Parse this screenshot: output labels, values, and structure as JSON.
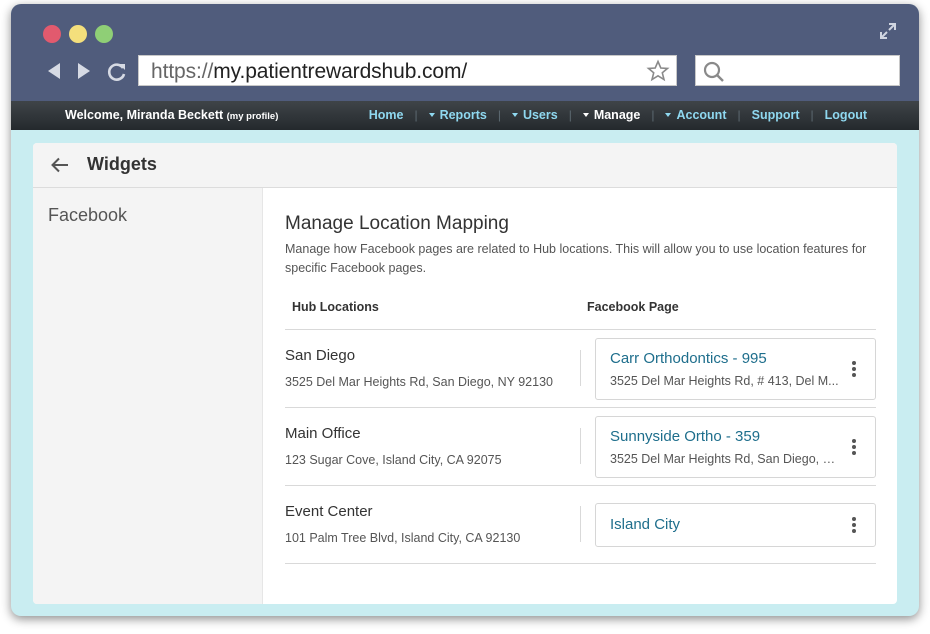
{
  "browser": {
    "url_scheme": "https://",
    "url_host": "my.patientrewardshub.com/",
    "search_value": ""
  },
  "topnav": {
    "welcome": "Welcome, Miranda Beckett",
    "profile_link": "(my profile)",
    "links": [
      {
        "label": "Home",
        "caret": false
      },
      {
        "label": "Reports",
        "caret": true
      },
      {
        "label": "Users",
        "caret": true
      },
      {
        "label": "Manage",
        "caret": true,
        "active": true
      },
      {
        "label": "Account",
        "caret": true
      },
      {
        "label": "Support",
        "caret": false
      },
      {
        "label": "Logout",
        "caret": false
      }
    ],
    "link_color": "#8fd8f0",
    "active_color": "#ffffff"
  },
  "page": {
    "title": "Widgets"
  },
  "sidebar": {
    "items": [
      {
        "label": "Facebook"
      }
    ]
  },
  "mapping": {
    "title": "Manage Location Mapping",
    "description": "Manage how Facebook pages are related to Hub locations. This will allow you to use location features for specific Facebook pages.",
    "col_hub": "Hub Locations",
    "col_fb": "Facebook Page",
    "rows": [
      {
        "location": "San Diego",
        "address": "3525 Del Mar Heights Rd, San Diego, NY 92130",
        "fb_page": "Carr Orthodontics - 995",
        "fb_address": "3525 Del Mar Heights Rd, # 413, Del M..."
      },
      {
        "location": "Main Office",
        "address": "123 Sugar Cove, Island City, CA 92075",
        "fb_page": "Sunnyside Ortho - 359",
        "fb_address": "3525 Del Mar Heights Rd, San Diego, C..."
      },
      {
        "location": "Event Center",
        "address": "101 Palm Tree Blvd, Island City, CA 92130",
        "fb_page": "Island City",
        "fb_address": ""
      }
    ]
  },
  "colors": {
    "chrome": "#505c7c",
    "background": "#c9edf1",
    "link": "#1e6e8c"
  }
}
